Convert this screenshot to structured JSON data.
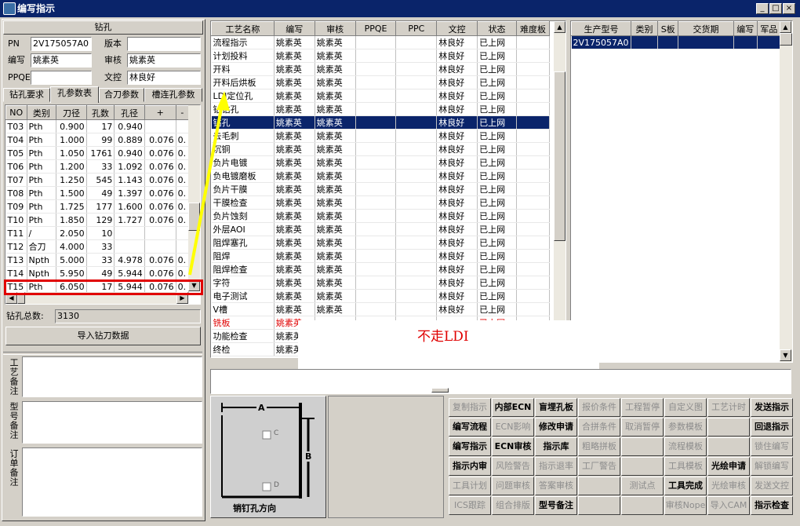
{
  "window": {
    "title": "编写指示"
  },
  "left": {
    "section_title": "钻孔",
    "pn_label": "PN",
    "pn_value": "2V175057A0",
    "version_label": "版本",
    "version_value": "",
    "author_label": "编写",
    "author_value": "姚素英",
    "reviewer_label": "审核",
    "reviewer_value": "姚素英",
    "ppqe_label": "PPQE",
    "ppqe_value": "",
    "docctrl_label": "文控",
    "docctrl_value": "林良好",
    "tabs": [
      "钻孔要求",
      "孔参数表",
      "合刀参数",
      "槽连孔参数"
    ],
    "table": {
      "headers": [
        "NO",
        "类别",
        "刀径",
        "孔数",
        "孔径",
        "+",
        "-"
      ],
      "rows": [
        [
          "T03",
          "Pth",
          "0.900",
          "17",
          "0.940",
          "",
          ""
        ],
        [
          "T04",
          "Pth",
          "1.000",
          "99",
          "0.889",
          "0.076",
          "0."
        ],
        [
          "T05",
          "Pth",
          "1.050",
          "1761",
          "0.940",
          "0.076",
          "0."
        ],
        [
          "T06",
          "Pth",
          "1.200",
          "33",
          "1.092",
          "0.076",
          "0."
        ],
        [
          "T07",
          "Pth",
          "1.250",
          "545",
          "1.143",
          "0.076",
          "0."
        ],
        [
          "T08",
          "Pth",
          "1.500",
          "49",
          "1.397",
          "0.076",
          "0."
        ],
        [
          "T09",
          "Pth",
          "1.725",
          "177",
          "1.600",
          "0.076",
          "0."
        ],
        [
          "T10",
          "Pth",
          "1.850",
          "129",
          "1.727",
          "0.076",
          "0."
        ],
        [
          "T11",
          "/",
          "2.050",
          "10",
          "",
          "",
          ""
        ],
        [
          "T12",
          "合刀",
          "4.000",
          "33",
          "",
          "",
          ""
        ],
        [
          "T13",
          "Npth",
          "5.000",
          "33",
          "4.978",
          "0.076",
          "0."
        ],
        [
          "T14",
          "Npth",
          "5.950",
          "49",
          "5.944",
          "0.076",
          "0."
        ],
        [
          "T15",
          "Pth",
          "6.050",
          "17",
          "5.944",
          "0.076",
          "0."
        ]
      ]
    },
    "total_label": "钻孔总数:",
    "total_value": "3130",
    "import_button": "导入钻刀数据",
    "notes": [
      {
        "label": "工艺备注"
      },
      {
        "label": "型号备注"
      },
      {
        "label": "订单备注"
      }
    ]
  },
  "process": {
    "headers": [
      "工艺名称",
      "编写",
      "审核",
      "PPQE",
      "PPC",
      "文控",
      "状态",
      "难度板"
    ],
    "rows": [
      [
        "流程指示",
        "姚素英",
        "姚素英",
        "",
        "",
        "林良好",
        "已上网",
        ""
      ],
      [
        "计划投料",
        "姚素英",
        "姚素英",
        "",
        "",
        "林良好",
        "已上网",
        ""
      ],
      [
        "开料",
        "姚素英",
        "姚素英",
        "",
        "",
        "林良好",
        "已上网",
        ""
      ],
      [
        "开料后烘板",
        "姚素英",
        "姚素英",
        "",
        "",
        "林良好",
        "已上网",
        ""
      ],
      [
        "LDI定位孔",
        "姚素英",
        "姚素英",
        "",
        "",
        "林良好",
        "已上网",
        ""
      ],
      [
        "钻钻孔",
        "姚素英",
        "姚素英",
        "",
        "",
        "林良好",
        "已上网",
        ""
      ],
      [
        "钻孔",
        "姚素英",
        "姚素英",
        "",
        "",
        "林良好",
        "已上网",
        ""
      ],
      [
        "去毛刺",
        "姚素英",
        "姚素英",
        "",
        "",
        "林良好",
        "已上网",
        ""
      ],
      [
        "沉铜",
        "姚素英",
        "姚素英",
        "",
        "",
        "林良好",
        "已上网",
        ""
      ],
      [
        "负片电镀",
        "姚素英",
        "姚素英",
        "",
        "",
        "林良好",
        "已上网",
        ""
      ],
      [
        "负电镀磨板",
        "姚素英",
        "姚素英",
        "",
        "",
        "林良好",
        "已上网",
        ""
      ],
      [
        "负片干膜",
        "姚素英",
        "姚素英",
        "",
        "",
        "林良好",
        "已上网",
        ""
      ],
      [
        "干膜检查",
        "姚素英",
        "姚素英",
        "",
        "",
        "林良好",
        "已上网",
        ""
      ],
      [
        "负片蚀刻",
        "姚素英",
        "姚素英",
        "",
        "",
        "林良好",
        "已上网",
        ""
      ],
      [
        "外层AOI",
        "姚素英",
        "姚素英",
        "",
        "",
        "林良好",
        "已上网",
        ""
      ],
      [
        "阻焊塞孔",
        "姚素英",
        "姚素英",
        "",
        "",
        "林良好",
        "已上网",
        ""
      ],
      [
        "阻焊",
        "姚素英",
        "姚素英",
        "",
        "",
        "林良好",
        "已上网",
        ""
      ],
      [
        "阻焊检查",
        "姚素英",
        "姚素英",
        "",
        "",
        "林良好",
        "已上网",
        ""
      ],
      [
        "字符",
        "姚素英",
        "姚素英",
        "",
        "",
        "林良好",
        "已上网",
        ""
      ],
      [
        "电子测试",
        "姚素英",
        "姚素英",
        "",
        "",
        "林良好",
        "已上网",
        ""
      ],
      [
        "V槽",
        "姚素英",
        "姚素英",
        "",
        "",
        "林良好",
        "已上网",
        ""
      ],
      [
        "铣板",
        "姚素英",
        "",
        "",
        "",
        "",
        "已上网",
        ""
      ],
      [
        "功能检查",
        "姚素英",
        "",
        "",
        "",
        "",
        "",
        ""
      ],
      [
        "终检",
        "姚素英",
        "",
        "",
        "",
        "",
        "",
        ""
      ]
    ]
  },
  "orders": {
    "headers": [
      "生产型号",
      "类别",
      "S板",
      "交货期",
      "编写",
      "军品"
    ],
    "rows": [
      [
        "2V175057A0",
        "",
        "",
        "",
        "",
        ""
      ]
    ]
  },
  "annotation": {
    "text": "不走LDI",
    "color": "#e00000"
  },
  "diagram": {
    "label_a": "A",
    "label_b": "B",
    "label_c": "C",
    "label_d": "D",
    "caption": "销钉孔方向"
  },
  "buttons": [
    [
      "复制指示",
      "内部ECN",
      "盲埋孔板",
      "报价条件",
      "工程暂停",
      "自定义图",
      "工艺计时",
      "发送指示"
    ],
    [
      "编写流程",
      "ECN影响",
      "修改申请",
      "合拼条件",
      "取消暂停",
      "参数模板",
      "",
      "回退指示"
    ],
    [
      "编写指示",
      "ECN审核",
      "指示库",
      "粗略拼板",
      "",
      "流程模板",
      "",
      "锁住编写"
    ],
    [
      "指示内审",
      "风险警告",
      "指示退率",
      "工厂警告",
      "",
      "工具模板",
      "光绘申请",
      "解锁编写"
    ],
    [
      "工具计划",
      "问题审核",
      "答案审核",
      "",
      "测试点",
      "工具完成",
      "光绘审核",
      "发送文控"
    ],
    [
      "ICS跟踪",
      "组合排版",
      "型号备注",
      "",
      "",
      "审核Nope",
      "导入CAM",
      "指示检查"
    ]
  ],
  "button_states": [
    [
      "dis",
      "bold",
      "bold",
      "dis",
      "dis",
      "dis",
      "dis",
      "bold"
    ],
    [
      "bold",
      "dis",
      "bold",
      "dis",
      "dis",
      "dis",
      "dis",
      "bold"
    ],
    [
      "bold",
      "bold",
      "bold",
      "dis",
      "dis",
      "dis",
      "dis",
      "dis"
    ],
    [
      "bold",
      "dis",
      "dis",
      "dis",
      "dis",
      "dis",
      "bold",
      "dis"
    ],
    [
      "dis",
      "dis",
      "dis",
      "dis",
      "dis",
      "bold",
      "dis",
      "dis"
    ],
    [
      "dis",
      "dis",
      "bold",
      "dis",
      "dis",
      "dis",
      "dis",
      "bold"
    ]
  ]
}
